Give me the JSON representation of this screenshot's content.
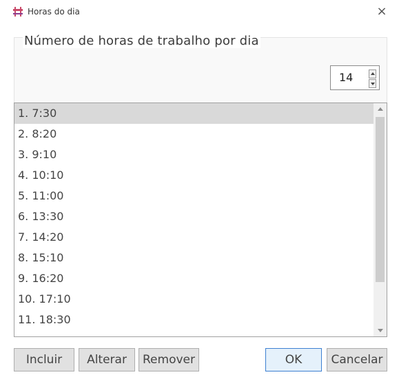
{
  "window": {
    "title": "Horas do dia",
    "close_glyph": "×",
    "icon": "app-window-icon"
  },
  "group": {
    "label": "Número de horas de trabalho por dia",
    "spinner_value": "14"
  },
  "list": {
    "items": [
      {
        "label": "1. 7:30",
        "selected": true
      },
      {
        "label": "2. 8:20"
      },
      {
        "label": "3. 9:10"
      },
      {
        "label": "4. 10:10"
      },
      {
        "label": "5. 11:00"
      },
      {
        "label": "6. 13:30"
      },
      {
        "label": "7. 14:20"
      },
      {
        "label": "8. 15:10"
      },
      {
        "label": "9. 16:20"
      },
      {
        "label": "10. 17:10"
      },
      {
        "label": "11. 18:30"
      }
    ]
  },
  "buttons": {
    "include": "Incluir",
    "alter": "Alterar",
    "remove": "Remover",
    "ok": "OK",
    "cancel": "Cancelar"
  },
  "colors": {
    "selection": "#d9d9d9",
    "default_button_border": "#3c7fd1",
    "button_face": "#e1e1e1"
  }
}
